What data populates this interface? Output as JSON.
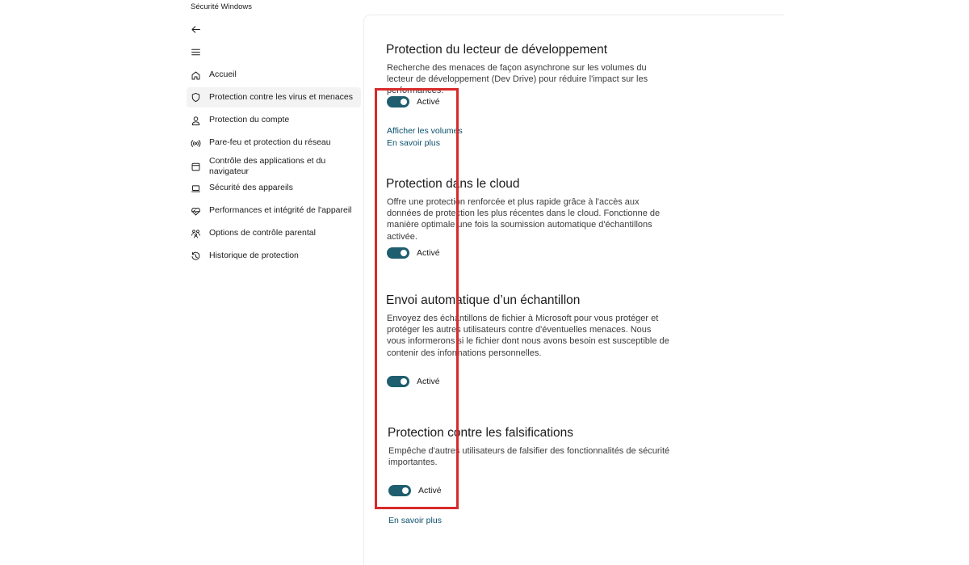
{
  "app": {
    "title": "Sécurité Windows"
  },
  "sidebar": {
    "items": [
      {
        "label": "Accueil",
        "icon": "home-icon"
      },
      {
        "label": "Protection contre les virus et menaces",
        "icon": "shield-icon",
        "selected": true
      },
      {
        "label": "Protection du compte",
        "icon": "person-icon"
      },
      {
        "label": "Pare-feu et protection du réseau",
        "icon": "wifi-antenna-icon"
      },
      {
        "label": "Contrôle des applications et du navigateur",
        "icon": "browser-window-icon"
      },
      {
        "label": "Sécurité des appareils",
        "icon": "laptop-icon"
      },
      {
        "label": "Performances et intégrité de l'appareil",
        "icon": "heart-pulse-icon"
      },
      {
        "label": "Options de contrôle parental",
        "icon": "family-icon"
      },
      {
        "label": "Historique de protection",
        "icon": "history-icon"
      }
    ]
  },
  "sections": [
    {
      "title": "Protection du lecteur de développement",
      "description": "Recherche des menaces de façon asynchrone sur les volumes du lecteur de développement (Dev Drive) pour réduire l'impact sur les performances.",
      "toggle_label": "Activé",
      "toggle_on": true,
      "links": [
        "Afficher les volumes",
        "En savoir plus"
      ]
    },
    {
      "title": "Protection dans le cloud",
      "description": "Offre une protection renforcée et plus rapide grâce à l'accès aux données de protection les plus récentes dans le cloud. Fonctionne de manière optimale une fois la soumission automatique d'échantillons activée.",
      "toggle_label": "Activé",
      "toggle_on": true
    },
    {
      "title": "Envoi automatique d’un échantillon",
      "description": "Envoyez des échantillons de fichier à Microsoft pour vous protéger et protéger les autres utilisateurs contre d'éventuelles menaces. Nous vous informerons si le fichier dont nous avons besoin est susceptible de contenir des informations personnelles.",
      "toggle_label": "Activé",
      "toggle_on": true
    },
    {
      "title": "Protection contre les falsifications",
      "description": "Empêche d'autres utilisateurs de falsifier des fonctionnalités de sécurité importantes.",
      "toggle_label": "Activé",
      "toggle_on": true,
      "links": [
        "En savoir plus"
      ]
    }
  ],
  "colors": {
    "toggle_on": "#1e5e6e",
    "link": "#0a4f6a",
    "highlight": "#d82a2a",
    "selected_bg": "#f3f3f3"
  }
}
